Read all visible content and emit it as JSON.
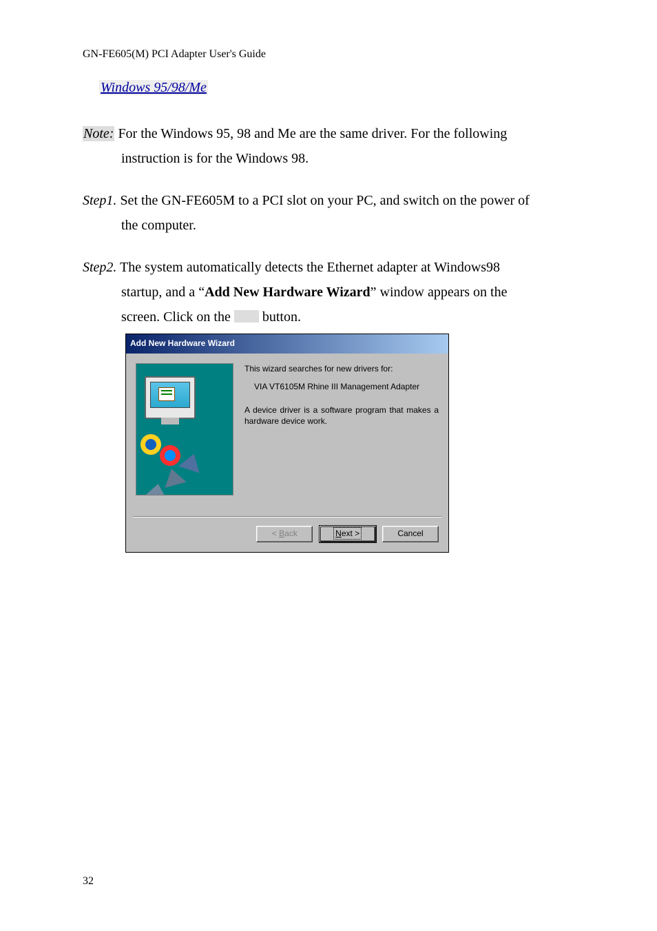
{
  "header": "GN-FE605(M) PCI Adapter User's Guide",
  "section_link": "Windows 95/98/Me",
  "note": {
    "label": "Note:",
    "line1_after_label": " For the Windows 95, 98 and Me are the same driver. For the following",
    "line2": "instruction is for the Windows 98."
  },
  "step1": {
    "label": "Step1.",
    "line1_after_label": " Set the GN-FE605M to a PCI slot on your PC, and switch on the power of",
    "line2": "the computer."
  },
  "step2": {
    "label": "Step2.",
    "t1": " The system automatically detects the Ethernet adapter at Windows98",
    "t2a": "startup, and a “",
    "bold": "Add New Hardware Wizard",
    "t2b": "” window appears on the",
    "t3a": "screen. Click on the ",
    "t3b": " button."
  },
  "dialog": {
    "title": "Add New Hardware Wizard",
    "line1": "This wizard searches for new drivers for:",
    "line2": "VIA VT6105M Rhine III Management Adapter",
    "line3": "A device driver is a software program that makes a hardware device work.",
    "back_u": "B",
    "back_rest": "ack",
    "back_prefix": "< ",
    "next_u": "N",
    "next_rest": "ext >",
    "cancel": "Cancel"
  },
  "pagenum": "32"
}
